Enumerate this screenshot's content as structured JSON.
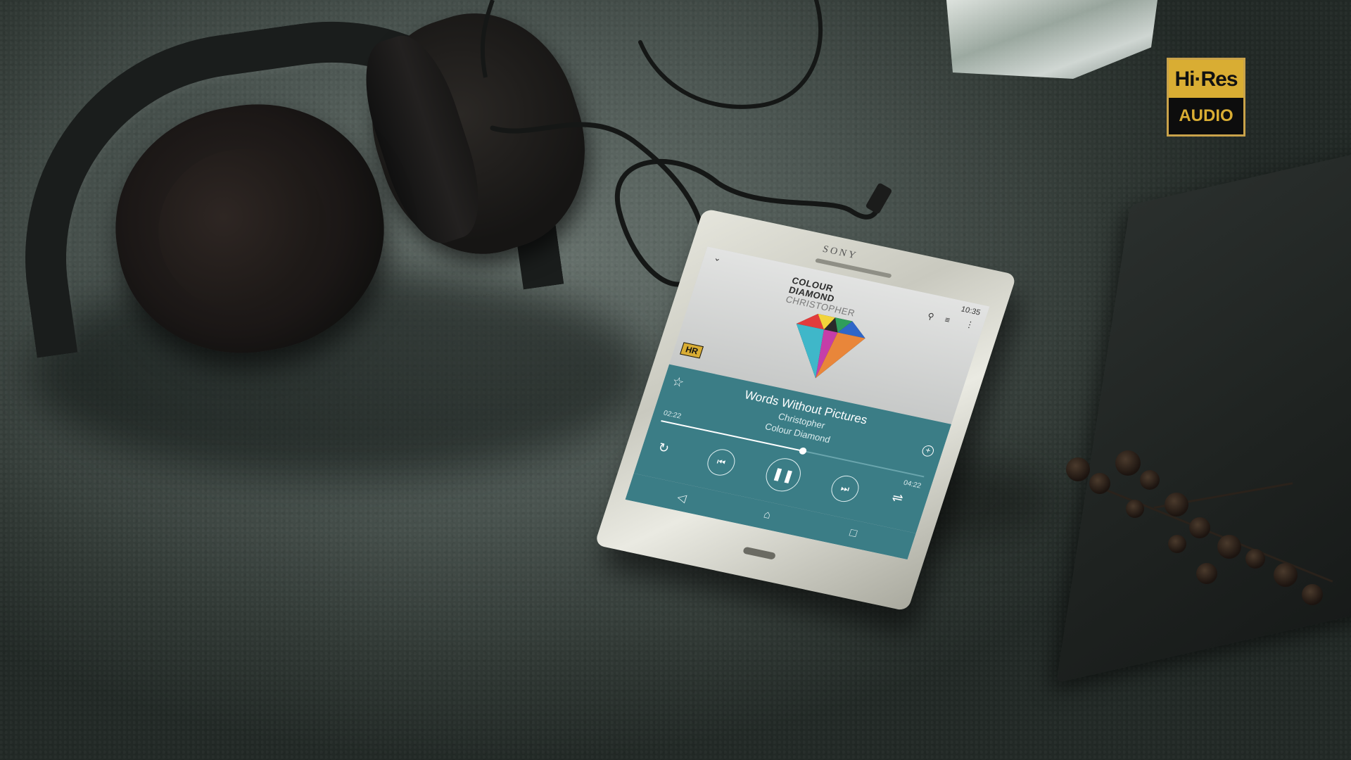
{
  "hires_logo": {
    "top": "Hi·Res",
    "bottom": "AUDIO",
    "gold": "#d9ad33",
    "black": "#0d0d0d"
  },
  "phone": {
    "brand": "SONY",
    "status_time": "10:35",
    "album_art": {
      "line1": "COLOUR",
      "line2": "DIAMOND",
      "line3": "CHRISTOPHER"
    },
    "hr_badge": "HR",
    "track": {
      "title": "Words Without Pictures",
      "artist": "Christopher",
      "album": "Colour Diamond",
      "elapsed": "02:22",
      "duration": "04:22",
      "progress_fraction": 0.54
    },
    "icons": [
      "chevron-down-icon",
      "search-icon",
      "queue-icon",
      "more-icon",
      "star-icon",
      "add-icon",
      "repeat-icon",
      "previous-icon",
      "pause-icon",
      "next-icon",
      "shuffle-icon",
      "back-icon",
      "home-icon",
      "recents-icon"
    ],
    "player_color": "#3b7d86"
  }
}
